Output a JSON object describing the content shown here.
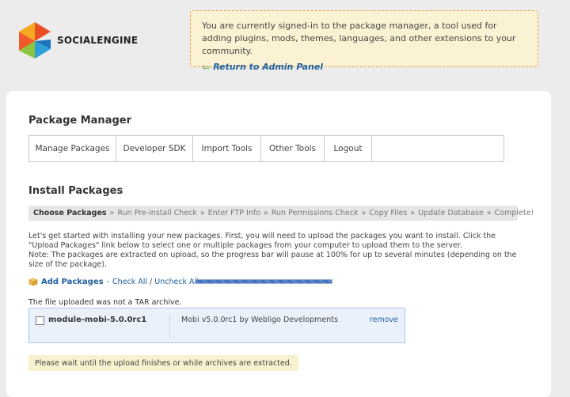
{
  "brand": {
    "name": "SOCIALENGINE"
  },
  "notice": {
    "text": "You are currently signed-in to the package manager, a tool used for adding plugins, mods, themes, languages, and other extensions to your community.",
    "back_link": "Return to Admin Panel"
  },
  "page": {
    "title": "Package Manager",
    "section_title": "Install Packages"
  },
  "tabs": [
    {
      "label": "Manage Packages"
    },
    {
      "label": "Developer SDK"
    },
    {
      "label": "Import Tools"
    },
    {
      "label": "Other Tools"
    },
    {
      "label": "Logout"
    }
  ],
  "steps": [
    {
      "label": "Choose Packages",
      "active": true
    },
    {
      "label": "Run Pre-install Check"
    },
    {
      "label": "Enter FTP Info"
    },
    {
      "label": "Run Permissions Check"
    },
    {
      "label": "Copy Files"
    },
    {
      "label": "Update Database"
    },
    {
      "label": "Complete!"
    }
  ],
  "intro": {
    "line1": "Let's get started with installing your new packages. First, you will need to upload the packages you want to install. Click the \"Upload Packages\" link below to select one or multiple packages from your computer to upload them to the server.",
    "line2": "Note: The packages are extracted on upload, so the progress bar will pause at 100% for up to several minutes (depending on the size of the package)."
  },
  "actions": {
    "add_packages": "Add Packages",
    "dash": "-",
    "check_all": "Check All",
    "slash": "/",
    "uncheck_all": "Uncheck All"
  },
  "upload": {
    "progress": 1.0,
    "error_message": "The file uploaded was not a TAR archive."
  },
  "package": {
    "name": "module-mobi-5.0.0rc1",
    "description": "Mobi v5.0.0rc1 by Webligo Developments",
    "remove_label": "remove",
    "checked": false
  },
  "wait_message": "Please wait until the upload finishes or while archives are extracted.",
  "colors": {
    "link": "#1f5f9e",
    "notice_bg": "#fbf2d3",
    "notice_border": "#e2a24c",
    "progress_fill": "#4372bb",
    "logo_colors": [
      "#e94e24",
      "#f7a823",
      "#2e9fd9",
      "#8cc63f"
    ]
  }
}
